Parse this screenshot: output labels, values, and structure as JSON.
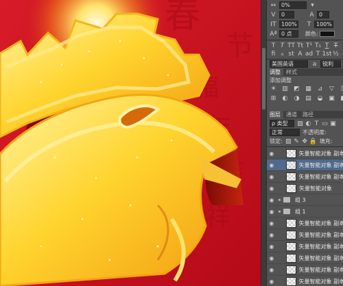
{
  "options_bar": {
    "percent_value": "0%",
    "spacing_value": "0",
    "leading_value": "0 点",
    "scale_v_value": "100%",
    "scale_h_value": "100%",
    "baseline_value": "0 点",
    "color_label": "颜色:"
  },
  "character_panel": {
    "language": "美国英语",
    "aa_label": "a",
    "aa_mode": "锐利"
  },
  "adjust_panel": {
    "tab_adjust": "调整",
    "tab_styles": "样式",
    "add_label": "添加调整",
    "icons": [
      "☀",
      "▥",
      "◩",
      "▦",
      "⊿",
      "▽",
      "☰",
      "⊞",
      "◐",
      "◑",
      "▤",
      "◒",
      "▣",
      "◧"
    ]
  },
  "layers_panel": {
    "tab_layers": "图层",
    "tab_channels": "通道",
    "tab_paths": "路径",
    "kind_filter": "ρ 类型",
    "blend_mode": "正常",
    "opacity_label": "不透明度:",
    "lock_label": "锁定:",
    "fill_label": "填充:",
    "layers": [
      {
        "name": "矢量智能对象 副本",
        "type": "layer",
        "selected": false
      },
      {
        "name": "矢量智能对象 副本",
        "type": "layer",
        "selected": true
      },
      {
        "name": "矢量智能对象 副本",
        "type": "layer",
        "selected": false
      },
      {
        "name": "矢量智能对象",
        "type": "layer",
        "selected": false
      },
      {
        "name": "组 3",
        "type": "group",
        "selected": false
      },
      {
        "name": "组 1",
        "type": "group",
        "selected": false
      },
      {
        "name": "矢量智能对象 副本",
        "type": "layer",
        "selected": false
      },
      {
        "name": "矢量智能对象 副本",
        "type": "layer",
        "selected": false
      },
      {
        "name": "矢量智能对象 副本",
        "type": "layer",
        "selected": false
      },
      {
        "name": "矢量智能对象 副本",
        "type": "layer",
        "selected": false
      },
      {
        "name": "矢量智能对象 副本",
        "type": "layer",
        "selected": false
      },
      {
        "name": "矢量智能对象 副本",
        "type": "layer",
        "selected": false
      }
    ]
  },
  "colors": {
    "canvas_red": "#c50d1d",
    "gold": "#ffd43a",
    "panel_gray": "#535353",
    "selection_blue": "#4f6a8c"
  }
}
